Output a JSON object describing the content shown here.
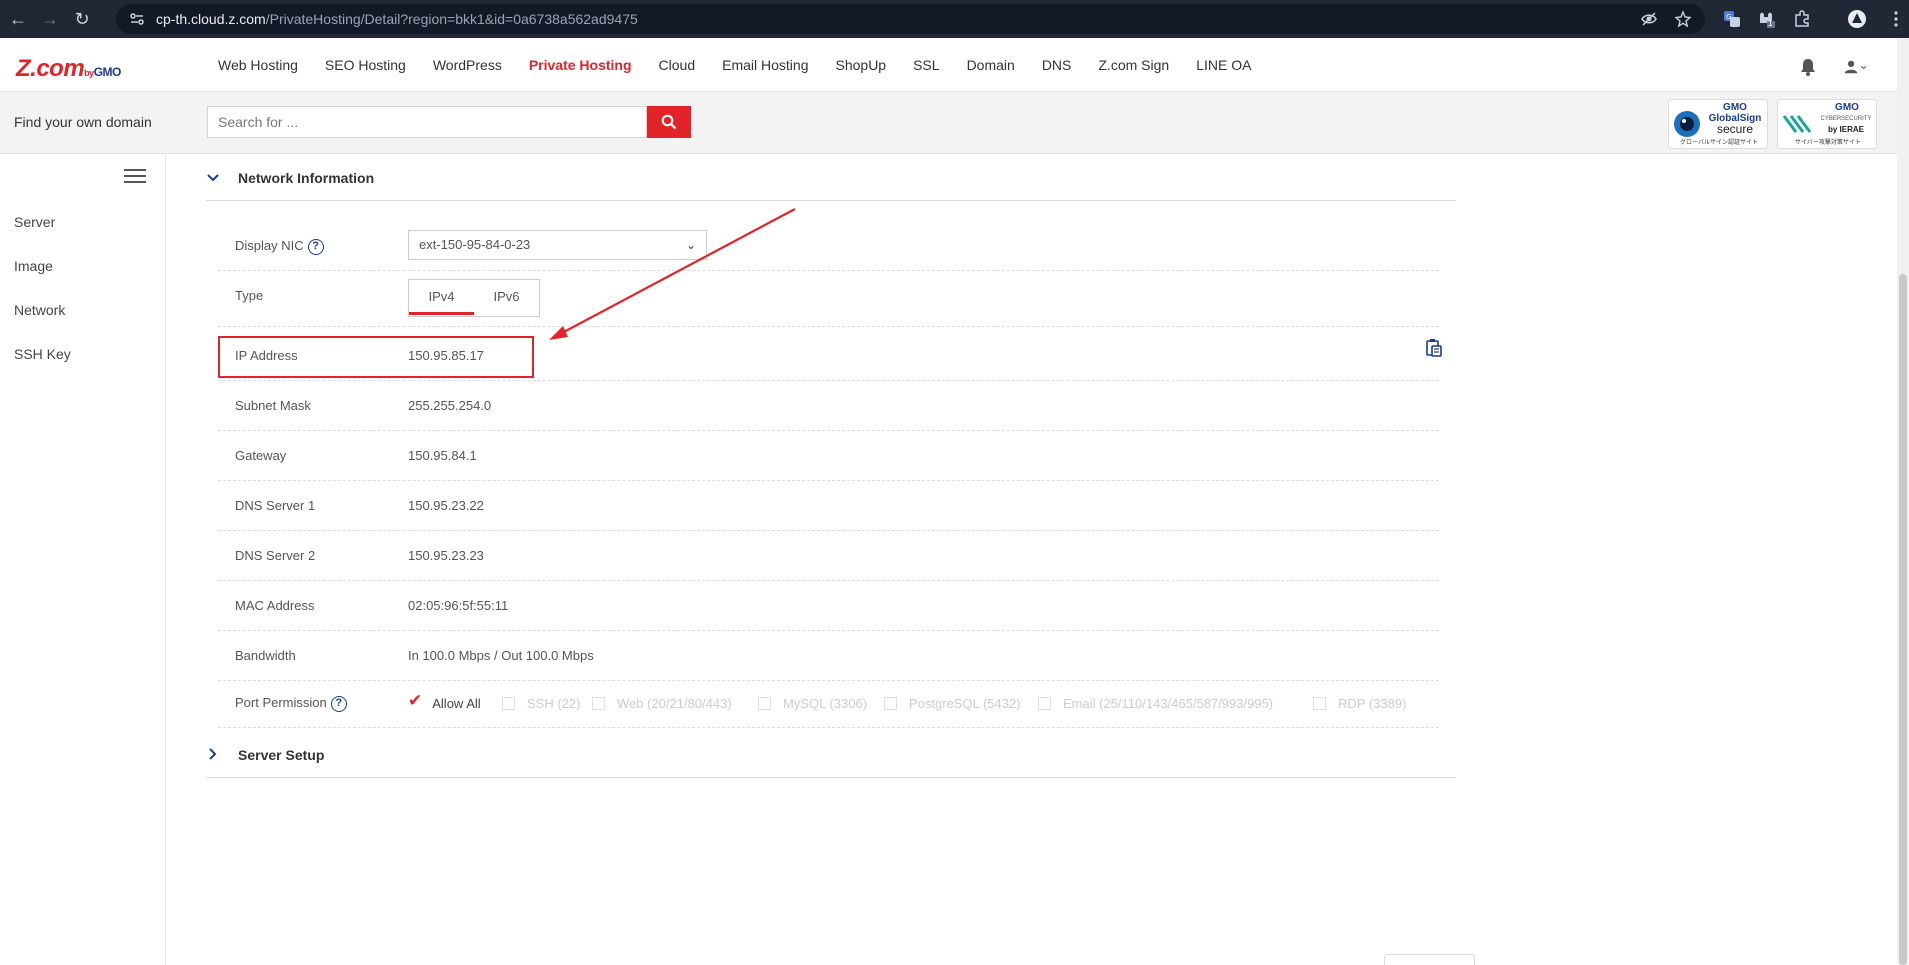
{
  "browser": {
    "url_host": "cp-th.cloud.z.com",
    "url_path": "/PrivateHosting/Detail?region=bkk1&id=0a6738a562ad9475",
    "ext_badge": "1"
  },
  "header": {
    "logo_text": "Z.com",
    "logo_by": "by",
    "logo_gmo": "GMO",
    "nav": [
      "Web Hosting",
      "SEO Hosting",
      "WordPress",
      "Private Hosting",
      "Cloud",
      "Email Hosting",
      "ShopUp",
      "SSL",
      "Domain",
      "DNS",
      "Z.com Sign",
      "LINE OA"
    ],
    "active_nav": "Private Hosting"
  },
  "search": {
    "label": "Find your own domain",
    "placeholder": "Search for ..."
  },
  "badges": {
    "globalsign": [
      "GMO",
      "GlobalSign",
      "secure",
      "グローバルサイン認証サイト"
    ],
    "ierae": [
      "GMO",
      "CYBERSECURITY",
      "by IERAE",
      "サイバー攻撃対策サイト"
    ]
  },
  "sidebar": {
    "items": [
      "Server",
      "Image",
      "Network",
      "SSH Key"
    ]
  },
  "network": {
    "title": "Network Information",
    "display_nic_label": "Display NIC",
    "display_nic_value": "ext-150-95-84-0-23",
    "type_label": "Type",
    "type_options": [
      "IPv4",
      "IPv6"
    ],
    "type_selected": "IPv4",
    "rows": [
      {
        "label": "IP Address",
        "value": "150.95.85.17"
      },
      {
        "label": "Subnet Mask",
        "value": "255.255.254.0"
      },
      {
        "label": "Gateway",
        "value": "150.95.84.1"
      },
      {
        "label": "DNS Server 1",
        "value": "150.95.23.22"
      },
      {
        "label": "DNS Server 2",
        "value": "150.95.23.23"
      },
      {
        "label": "MAC Address",
        "value": "02:05:96:5f:55:11"
      },
      {
        "label": "Bandwidth",
        "value": "In 100.0 Mbps / Out 100.0 Mbps"
      }
    ],
    "port_permission_label": "Port Permission",
    "ports": [
      {
        "label": "Allow All",
        "checked": true
      },
      {
        "label": "SSH (22)",
        "checked": false
      },
      {
        "label": "Web (20/21/80/443)",
        "checked": false
      },
      {
        "label": "MySQL (3306)",
        "checked": false
      },
      {
        "label": "PostgreSQL (5432)",
        "checked": false
      },
      {
        "label": "Email (25/110/143/465/587/993/995)",
        "checked": false
      },
      {
        "label": "RDP (3389)",
        "checked": false
      }
    ]
  },
  "server_setup": {
    "title": "Server Setup"
  },
  "colors": {
    "accent": "#e3232a",
    "brand_blue": "#1a3c8f",
    "chrome_bg": "#202735"
  }
}
